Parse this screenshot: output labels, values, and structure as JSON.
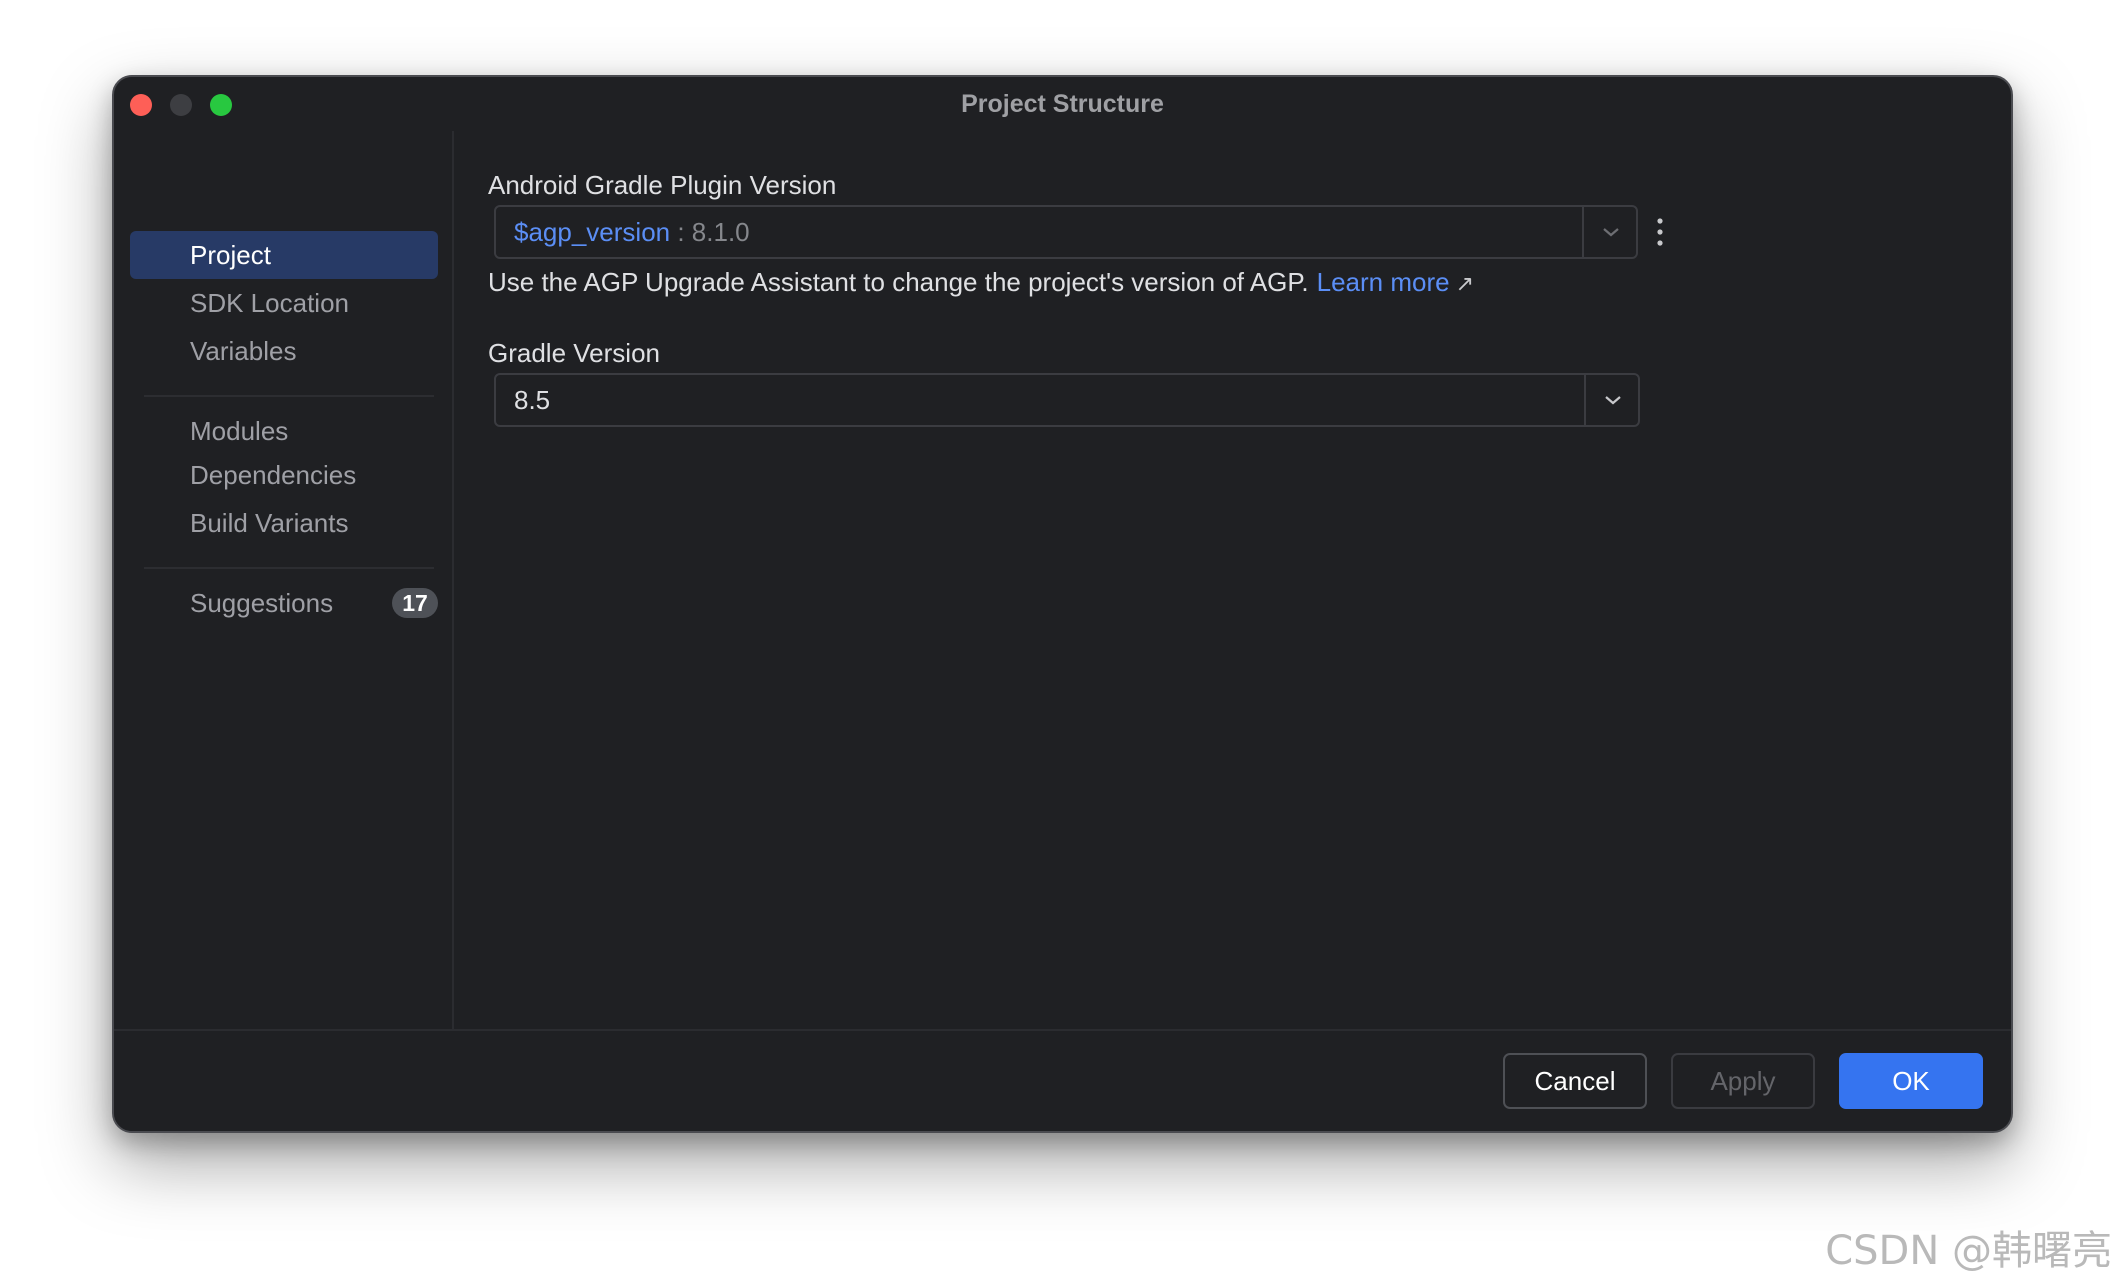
{
  "window": {
    "title": "Project Structure"
  },
  "nav": {
    "back_icon": "←",
    "forward_icon": "→"
  },
  "sidebar": {
    "items": [
      {
        "label": "Project",
        "selected": true
      },
      {
        "label": "SDK Location"
      },
      {
        "label": "Variables"
      },
      {
        "label": "Modules"
      },
      {
        "label": "Dependencies"
      },
      {
        "label": "Build Variants"
      },
      {
        "label": "Suggestions",
        "badge": "17"
      }
    ]
  },
  "agp": {
    "label": "Android Gradle Plugin Version",
    "variable": "$agp_version",
    "separator": " : ",
    "value": "8.1.0",
    "hint": "Use the AGP Upgrade Assistant to change the project's version of AGP.",
    "link": "Learn more",
    "link_icon": "↗"
  },
  "gradle": {
    "label": "Gradle Version",
    "value": "8.5"
  },
  "footer": {
    "cancel": "Cancel",
    "apply": "Apply",
    "ok": "OK"
  },
  "watermark": "CSDN @韩曙亮",
  "colors": {
    "accent": "#3574f0",
    "link": "#5b8ef5",
    "selection": "#273a66",
    "background": "#1f2023"
  }
}
